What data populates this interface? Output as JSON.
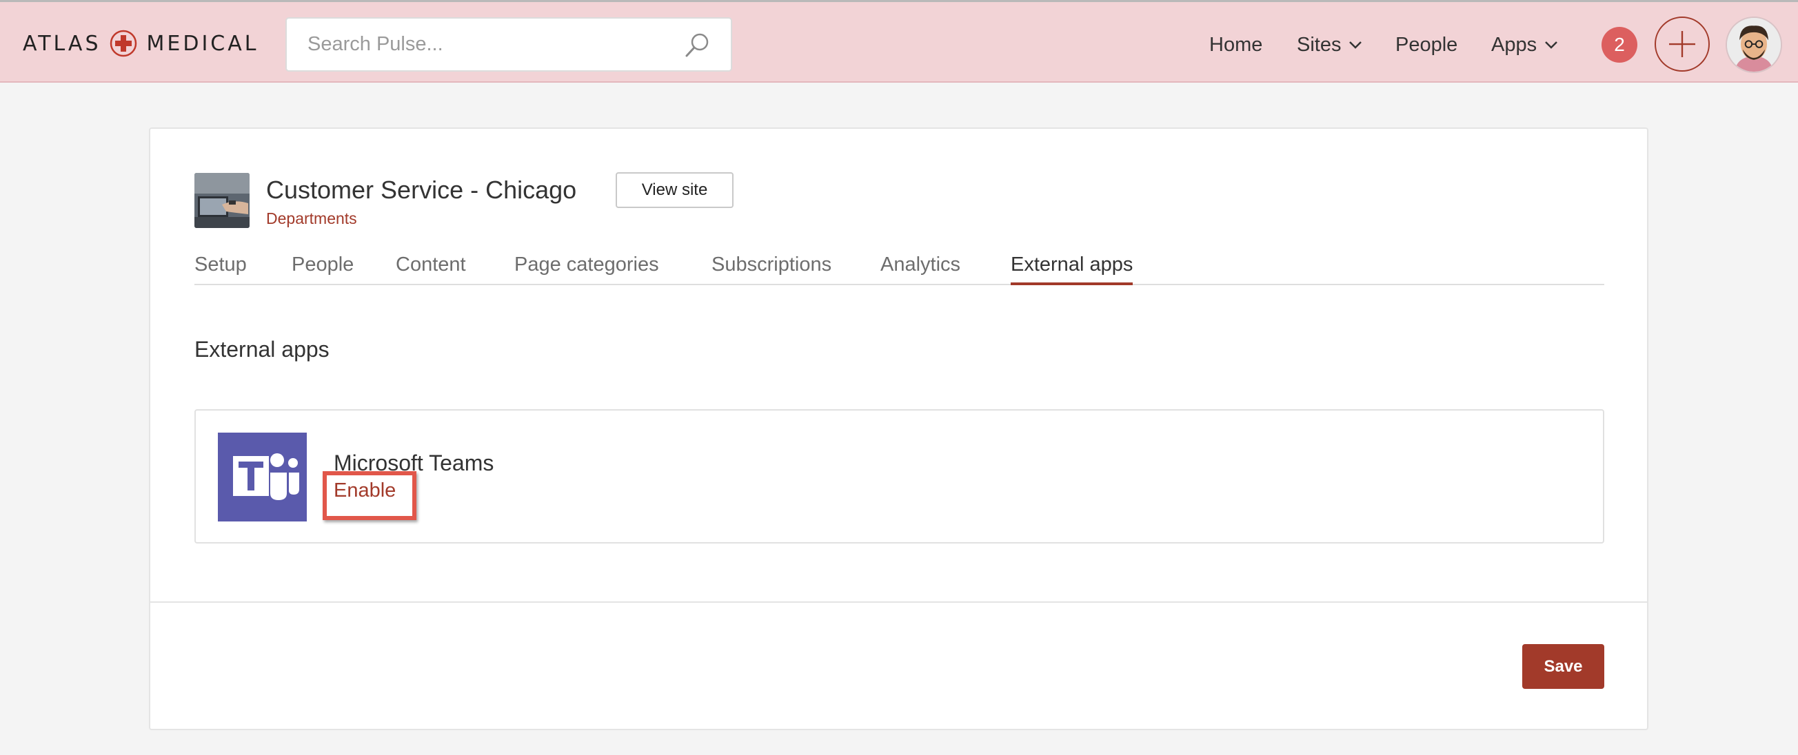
{
  "header": {
    "logo": {
      "left": "ATLAS",
      "right": "MEDICAL",
      "icon": "medical-cross-icon"
    },
    "search": {
      "placeholder": "Search Pulse...",
      "value": "",
      "icon": "search-icon"
    },
    "nav": [
      {
        "label": "Home"
      },
      {
        "label": "Sites",
        "icon": "chevron-down-icon"
      },
      {
        "label": "People"
      },
      {
        "label": "Apps",
        "icon": "chevron-down-icon"
      }
    ],
    "notifications_count": "2",
    "add_icon": "plus-icon",
    "avatar_icon": "user-avatar"
  },
  "site": {
    "title": "Customer Service - Chicago",
    "subtitle": "Departments",
    "view_site_label": "View site"
  },
  "tabs": [
    {
      "label": "Setup"
    },
    {
      "label": "People"
    },
    {
      "label": "Content"
    },
    {
      "label": "Page categories"
    },
    {
      "label": "Subscriptions"
    },
    {
      "label": "Analytics"
    },
    {
      "label": "External apps",
      "active": true
    }
  ],
  "section": {
    "title": "External apps",
    "apps": [
      {
        "name": "Microsoft Teams",
        "action_label": "Enable",
        "icon": "microsoft-teams-icon"
      }
    ]
  },
  "footer": {
    "save_label": "Save"
  },
  "colors": {
    "accent": "#a23a2a",
    "header_bg": "#f2d3d6",
    "badge": "#dc5f5f",
    "teams": "#5a5aac",
    "highlight": "#e1574a"
  }
}
